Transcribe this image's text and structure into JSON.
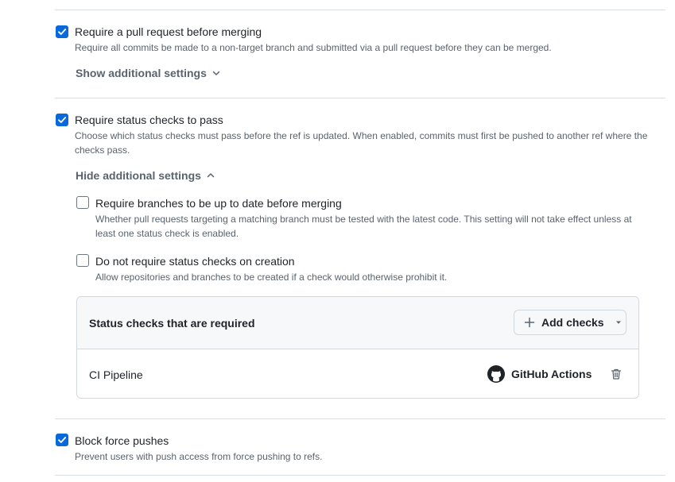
{
  "rules": [
    {
      "label": "Require a pull request before merging",
      "description": "Require all commits be made to a non-target branch and submitted via a pull request before they can be merged.",
      "checked": true,
      "toggle_label": "Show additional settings"
    },
    {
      "label": "Require status checks to pass",
      "description_line1": "Choose which status checks must pass before the ref is updated. When enabled, commits must first be pushed to another ref where the",
      "description_line2": "checks pass.",
      "checked": true,
      "toggle_label": "Hide additional settings",
      "sub_options": [
        {
          "label": "Require branches to be up to date before merging",
          "description_line1": "Whether pull requests targeting a matching branch must be tested with the latest code. This setting will not take effect unless at",
          "description_line2": "least one status check is enabled.",
          "checked": false
        },
        {
          "label": "Do not require status checks on creation",
          "description": "Allow repositories and branches to be created if a check would otherwise prohibit it.",
          "checked": false
        }
      ],
      "checks_panel": {
        "title": "Status checks that are required",
        "add_button_label": "Add checks",
        "checks": [
          {
            "name": "CI Pipeline",
            "app": "GitHub Actions",
            "app_icon": "github-logo-icon",
            "delete_icon": "trash-icon"
          }
        ]
      }
    },
    {
      "label": "Block force pushes",
      "description": "Prevent users with push access from force pushing to refs.",
      "checked": true
    }
  ],
  "colors": {
    "accent": "#0969da",
    "text_primary": "#1f2328",
    "text_muted": "#59636e",
    "border": "#d1d9e0"
  }
}
